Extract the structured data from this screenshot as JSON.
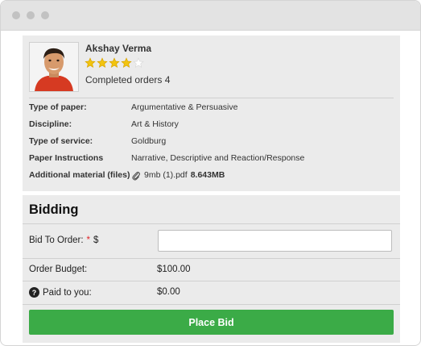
{
  "profile": {
    "name": "Akshay Verma",
    "rating": 4,
    "rating_max": 5,
    "completed_orders": "Completed orders 4",
    "star_color": "#f2c40f",
    "star_empty_color": "#d9d9d9"
  },
  "details": [
    {
      "label": "Type of paper:",
      "value": "Argumentative & Persuasive"
    },
    {
      "label": "Discipline:",
      "value": "Art & History"
    },
    {
      "label": "Type of service:",
      "value": "Goldburg"
    },
    {
      "label": "Paper Instructions",
      "value": "Narrative, Descriptive and Reaction/Response"
    }
  ],
  "attachment": {
    "label": "Additional material (files)",
    "file_name": "9mb (1).pdf",
    "file_size": "8.643MB",
    "icon": "paperclip-icon"
  },
  "bidding": {
    "title": "Bidding",
    "bid_label": "Bid To Order:",
    "required_mark": "*",
    "currency": "$",
    "bid_value": "",
    "budget_label": "Order Budget:",
    "budget_value": "$100.00",
    "paid_label": "Paid to you:",
    "paid_value": "$0.00",
    "help_icon": "question-icon",
    "button_label": "Place Bid",
    "button_color": "#3bab47"
  }
}
